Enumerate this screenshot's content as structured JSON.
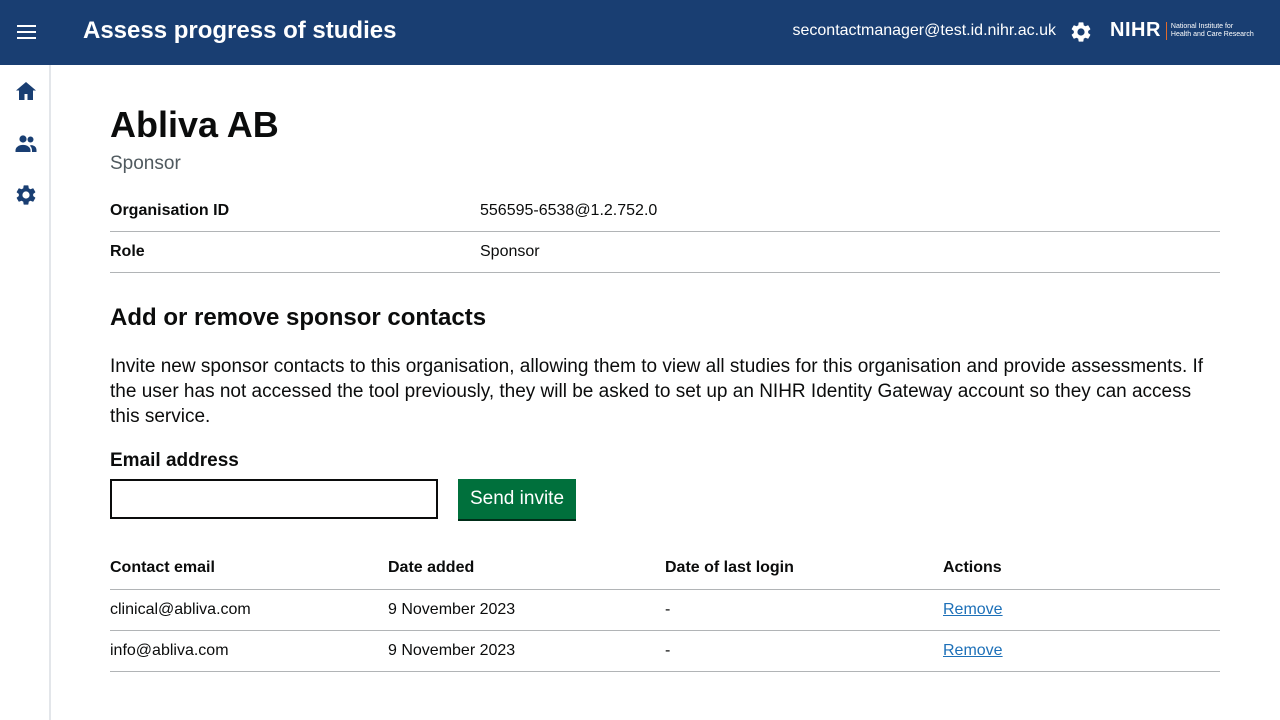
{
  "header": {
    "title": "Assess progress of studies",
    "user_email": "secontactmanager@test.id.nihr.ac.uk",
    "logo_text": "NIHR",
    "logo_subtext_line1": "National Institute for",
    "logo_subtext_line2": "Health and Care Research",
    "background_color": "#193e72",
    "logo_accent_color": "#e06b2c"
  },
  "sidebar": {
    "items": [
      {
        "icon": "home-icon"
      },
      {
        "icon": "users-icon"
      },
      {
        "icon": "gear-icon"
      }
    ]
  },
  "organisation": {
    "name": "Abliva AB",
    "type": "Sponsor",
    "summary": [
      {
        "key": "Organisation ID",
        "value": "556595-6538@1.2.752.0"
      },
      {
        "key": "Role",
        "value": "Sponsor"
      }
    ]
  },
  "contacts_section": {
    "title": "Add or remove sponsor contacts",
    "intro": "Invite new sponsor contacts to this organisation, allowing them to view all studies for this organisation and provide assessments. If the user has not accessed the tool previously, they will be asked to set up an NIHR Identity Gateway account so they can access this service.",
    "email_label": "Email address",
    "email_value": "",
    "send_button": "Send invite",
    "send_button_color": "#00703c",
    "table": {
      "headers": [
        "Contact email",
        "Date added",
        "Date of last login",
        "Actions"
      ],
      "rows": [
        {
          "email": "clinical@abliva.com",
          "date_added": "9 November 2023",
          "last_login": "-",
          "action": "Remove"
        },
        {
          "email": "info@abliva.com",
          "date_added": "9 November 2023",
          "last_login": "-",
          "action": "Remove"
        }
      ]
    },
    "link_color": "#1d70b8"
  }
}
